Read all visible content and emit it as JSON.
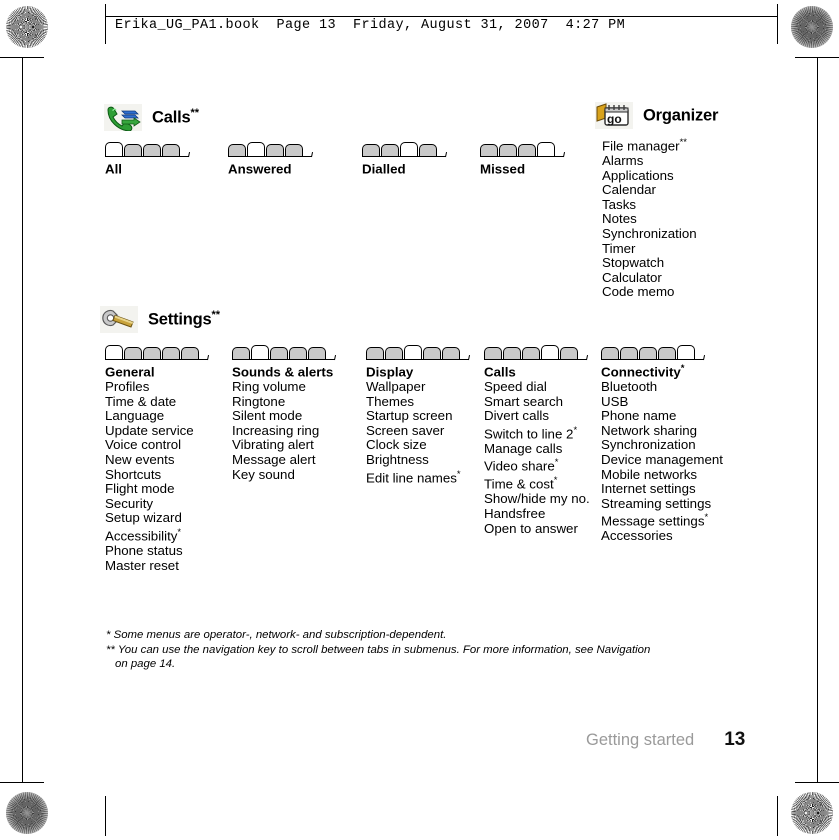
{
  "print_header": {
    "text": "Erika_UG_PA1.book  Page 13  Friday, August 31, 2007  4:27 PM"
  },
  "sections": [
    {
      "id": "calls",
      "icon": "calls-icon",
      "title": "Calls",
      "title_sup": "**",
      "columns": [
        {
          "title": "All",
          "title_sup": "",
          "tabs_total": 4,
          "tabs_active": 1,
          "items": []
        },
        {
          "title": "Answered",
          "title_sup": "",
          "tabs_total": 4,
          "tabs_active": 2,
          "items": []
        },
        {
          "title": "Dialled",
          "title_sup": "",
          "tabs_total": 4,
          "tabs_active": 3,
          "items": []
        },
        {
          "title": "Missed",
          "title_sup": "",
          "tabs_total": 4,
          "tabs_active": 4,
          "items": []
        }
      ]
    },
    {
      "id": "organizer",
      "icon": "organizer-icon",
      "title": "Organizer",
      "title_sup": "",
      "columns": [
        {
          "title": "",
          "title_sup": "",
          "tabs_total": 0,
          "tabs_active": 0,
          "items": [
            {
              "label": "File manager",
              "sup": "**"
            },
            {
              "label": "Alarms",
              "sup": ""
            },
            {
              "label": "Applications",
              "sup": ""
            },
            {
              "label": "Calendar",
              "sup": ""
            },
            {
              "label": "Tasks",
              "sup": ""
            },
            {
              "label": "Notes",
              "sup": ""
            },
            {
              "label": "Synchronization",
              "sup": ""
            },
            {
              "label": "Timer",
              "sup": ""
            },
            {
              "label": "Stopwatch",
              "sup": ""
            },
            {
              "label": "Calculator",
              "sup": ""
            },
            {
              "label": "Code memo",
              "sup": ""
            }
          ]
        }
      ]
    },
    {
      "id": "settings",
      "icon": "settings-icon",
      "title": "Settings",
      "title_sup": "**",
      "columns": [
        {
          "title": "General",
          "title_sup": "",
          "tabs_total": 5,
          "tabs_active": 1,
          "items": [
            {
              "label": "Profiles",
              "sup": ""
            },
            {
              "label": "Time & date",
              "sup": ""
            },
            {
              "label": "Language",
              "sup": ""
            },
            {
              "label": "Update service",
              "sup": ""
            },
            {
              "label": "Voice control",
              "sup": ""
            },
            {
              "label": "New events",
              "sup": ""
            },
            {
              "label": "Shortcuts",
              "sup": ""
            },
            {
              "label": "Flight mode",
              "sup": ""
            },
            {
              "label": "Security",
              "sup": ""
            },
            {
              "label": "Setup wizard",
              "sup": ""
            },
            {
              "label": "Accessibility",
              "sup": "*"
            },
            {
              "label": "Phone status",
              "sup": ""
            },
            {
              "label": "Master reset",
              "sup": ""
            }
          ]
        },
        {
          "title": "Sounds & alerts",
          "title_sup": "",
          "tabs_total": 5,
          "tabs_active": 2,
          "items": [
            {
              "label": "Ring volume",
              "sup": ""
            },
            {
              "label": "Ringtone",
              "sup": ""
            },
            {
              "label": "Silent mode",
              "sup": ""
            },
            {
              "label": "Increasing ring",
              "sup": ""
            },
            {
              "label": "Vibrating alert",
              "sup": ""
            },
            {
              "label": "Message alert",
              "sup": ""
            },
            {
              "label": "Key sound",
              "sup": ""
            }
          ]
        },
        {
          "title": "Display",
          "title_sup": "",
          "tabs_total": 5,
          "tabs_active": 3,
          "items": [
            {
              "label": "Wallpaper",
              "sup": ""
            },
            {
              "label": "Themes",
              "sup": ""
            },
            {
              "label": "Startup screen",
              "sup": ""
            },
            {
              "label": "Screen saver",
              "sup": ""
            },
            {
              "label": "Clock size",
              "sup": ""
            },
            {
              "label": "Brightness",
              "sup": ""
            },
            {
              "label": "Edit line names",
              "sup": "*"
            }
          ]
        },
        {
          "title": "Calls",
          "title_sup": "",
          "tabs_total": 5,
          "tabs_active": 4,
          "items": [
            {
              "label": "Speed dial",
              "sup": ""
            },
            {
              "label": "Smart search",
              "sup": ""
            },
            {
              "label": "Divert calls",
              "sup": ""
            },
            {
              "label": "Switch to line 2",
              "sup": "*"
            },
            {
              "label": "Manage calls",
              "sup": ""
            },
            {
              "label": "Video share",
              "sup": "*"
            },
            {
              "label": "Time & cost",
              "sup": "*"
            },
            {
              "label": "Show/hide my no.",
              "sup": ""
            },
            {
              "label": "Handsfree",
              "sup": ""
            },
            {
              "label": "Open to answer",
              "sup": ""
            }
          ]
        },
        {
          "title": "Connectivity",
          "title_sup": "*",
          "tabs_total": 5,
          "tabs_active": 5,
          "items": [
            {
              "label": "Bluetooth",
              "sup": ""
            },
            {
              "label": "USB",
              "sup": ""
            },
            {
              "label": "Phone name",
              "sup": ""
            },
            {
              "label": "Network sharing",
              "sup": ""
            },
            {
              "label": "Synchronization",
              "sup": ""
            },
            {
              "label": "Device management",
              "sup": ""
            },
            {
              "label": "Mobile networks",
              "sup": ""
            },
            {
              "label": "Internet settings",
              "sup": ""
            },
            {
              "label": "Streaming settings",
              "sup": ""
            },
            {
              "label": "Message settings",
              "sup": "*"
            },
            {
              "label": "Accessories",
              "sup": ""
            }
          ]
        }
      ]
    }
  ],
  "footnotes": {
    "line1": "* Some menus are operator-, network- and subscription-dependent.",
    "line2": "** You can use the navigation key to scroll between tabs in submenus. For more information, see Navigation",
    "line3": "on page 14."
  },
  "footer": {
    "chapter": "Getting started",
    "page_number": "13"
  },
  "colors": {
    "tab_inactive": "#c9c9c9",
    "tab_active": "#ffffff",
    "footer_chapter": "#9a9a9a",
    "rule": "#000000"
  }
}
